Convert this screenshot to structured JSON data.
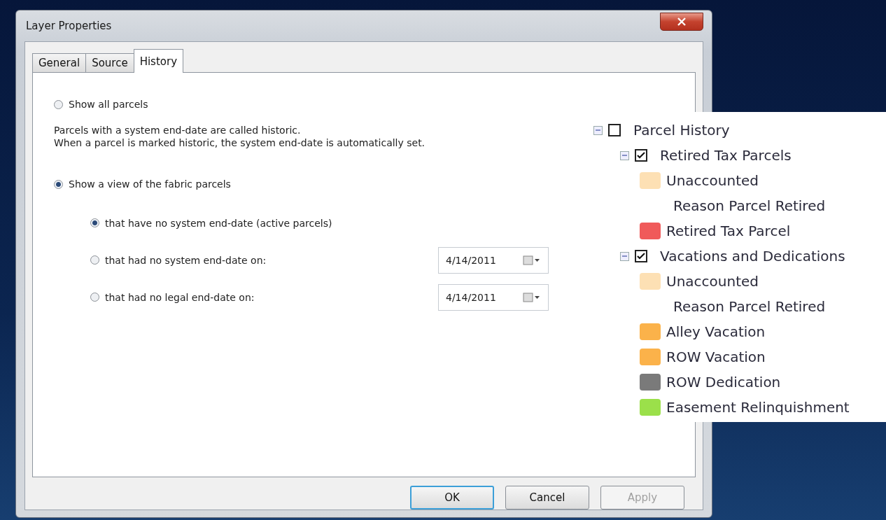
{
  "dialog": {
    "title": "Layer Properties",
    "tabs": [
      {
        "label": "General",
        "selected": false
      },
      {
        "label": "Source",
        "selected": false
      },
      {
        "label": "History",
        "selected": true
      }
    ],
    "show_all": {
      "label": "Show all parcels",
      "selected": false
    },
    "note": [
      "Parcels with a system end-date are called historic.",
      "When a parcel is marked historic, the system end-date is automatically set."
    ],
    "show_view": {
      "label": "Show a view of the fabric parcels",
      "selected": true
    },
    "view_options": [
      {
        "label": "that have no system end-date (active parcels)",
        "selected": true
      },
      {
        "label": "that had no system end-date on:",
        "selected": false,
        "date": "4/14/2011"
      },
      {
        "label": "that had no legal end-date on:",
        "selected": false,
        "date": "4/14/2011"
      }
    ],
    "buttons": [
      {
        "label": "OK",
        "disabled": false,
        "default": true
      },
      {
        "label": "Cancel",
        "disabled": false,
        "default": false
      },
      {
        "label": "Apply",
        "disabled": true,
        "default": false
      }
    ]
  },
  "legend": [
    {
      "kind": "group",
      "label": "Parcel History",
      "checked": false,
      "expanded": true,
      "children": [
        {
          "kind": "group",
          "label": "Retired Tax Parcels",
          "checked": true,
          "expanded": true,
          "children": [
            {
              "kind": "class",
              "label": "Unaccounted",
              "color": "#fde0b4"
            },
            {
              "kind": "heading",
              "label": "Reason Parcel Retired"
            },
            {
              "kind": "class",
              "label": "Retired Tax Parcel",
              "color": "#f05a5a"
            }
          ]
        },
        {
          "kind": "group",
          "label": "Vacations and Dedications",
          "checked": true,
          "expanded": true,
          "children": [
            {
              "kind": "class",
              "label": "Unaccounted",
              "color": "#fde0b4"
            },
            {
              "kind": "heading",
              "label": "Reason Parcel Retired"
            },
            {
              "kind": "class",
              "label": "Alley Vacation",
              "color": "#fbb24a"
            },
            {
              "kind": "class",
              "label": "ROW Vacation",
              "color": "#fbb24a"
            },
            {
              "kind": "class",
              "label": "ROW Dedication",
              "color": "#7a7a7a"
            },
            {
              "kind": "class",
              "label": "Easement Relinquishment",
              "color": "#9be04a"
            }
          ]
        }
      ]
    }
  ]
}
